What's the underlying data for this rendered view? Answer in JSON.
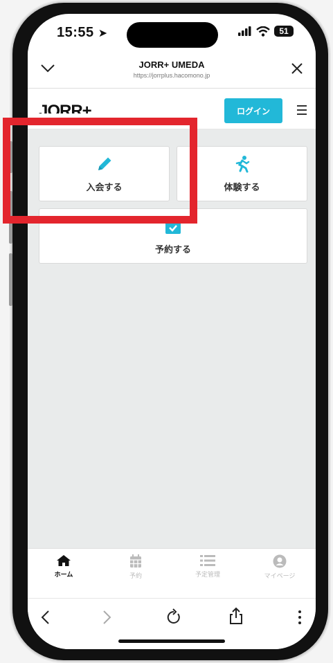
{
  "status_bar": {
    "time": "15:55",
    "battery": "51"
  },
  "browser_header": {
    "title": "JORR+ UMEDA",
    "url": "https://jorrplus.hacomono.jp"
  },
  "site_header": {
    "logo": "JORR+",
    "login_label": "ログイン"
  },
  "cards": [
    {
      "label": "入会する",
      "icon": "pencil-icon"
    },
    {
      "label": "体験する",
      "icon": "running-person-icon"
    },
    {
      "label": "予約する",
      "icon": "calendar-check-icon"
    }
  ],
  "tabs": [
    {
      "label": "ホーム",
      "icon": "home-icon",
      "active": true
    },
    {
      "label": "予約",
      "icon": "calendar-icon",
      "active": false
    },
    {
      "label": "予定管理",
      "icon": "list-icon",
      "active": false
    },
    {
      "label": "マイページ",
      "icon": "user-icon",
      "active": false
    }
  ],
  "colors": {
    "accent": "#22b8d8",
    "highlight": "#e3252d",
    "content_bg": "#e9ebeb"
  }
}
